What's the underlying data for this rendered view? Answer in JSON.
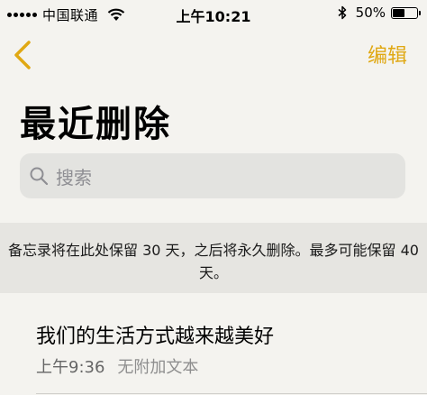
{
  "status_bar": {
    "carrier": "中国联通",
    "time": "上午10:21",
    "battery_percent": "50%",
    "battery_level": 0.5
  },
  "nav": {
    "back_icon": "chevron-left-icon",
    "edit_label": "编辑",
    "accent_color": "#e0a813"
  },
  "page": {
    "title": "最近删除"
  },
  "search": {
    "placeholder": "搜索"
  },
  "info": {
    "text": "备忘录将在此处保留 30 天，之后将永久删除。最多可能保留 40 天。"
  },
  "notes": [
    {
      "title": "我们的生活方式越来越美好",
      "time": "上午9:36",
      "preview": "无附加文本"
    }
  ]
}
